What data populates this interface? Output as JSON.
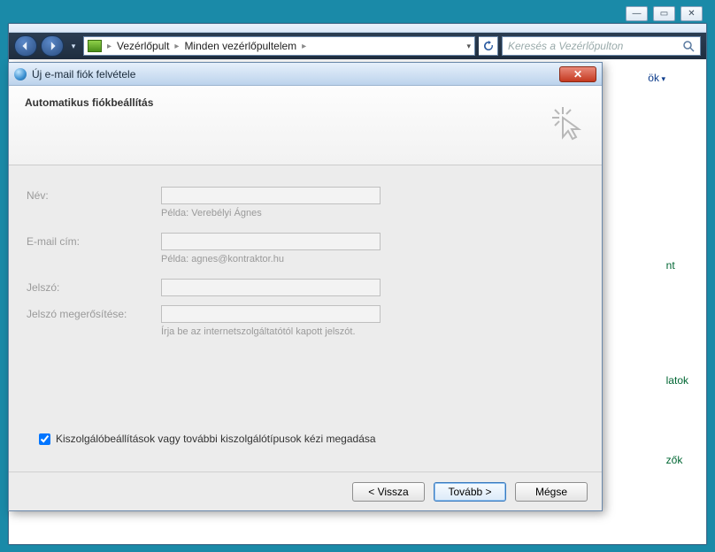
{
  "window_buttons": {
    "minimize": "—",
    "maximize": "▭",
    "close": "✕"
  },
  "breadcrumbs": {
    "root_icon": "control-panel",
    "items": [
      "Vezérlőpult",
      "Minden vezérlőpultelem"
    ]
  },
  "search": {
    "placeholder": "Keresés a Vezérlőpulton"
  },
  "tools_link": "ök",
  "peek_links": [
    "nt",
    "latok",
    "zők"
  ],
  "dialog": {
    "title": "Új e-mail fiók felvétele",
    "heading": "Automatikus fiókbeállítás",
    "fields": {
      "name": {
        "label": "Név:",
        "value": "",
        "hint": "Példa: Verebélyi Ágnes"
      },
      "email": {
        "label": "E-mail cím:",
        "value": "",
        "hint": "Példa: agnes@kontraktor.hu"
      },
      "password": {
        "label": "Jelszó:",
        "value": ""
      },
      "password_confirm": {
        "label": "Jelszó megerősítése:",
        "value": "",
        "hint": "Írja be az internetszolgáltatótól kapott jelszót."
      }
    },
    "checkbox": {
      "checked": true,
      "label": "Kiszolgálóbeállítások vagy további kiszolgálótípusok kézi megadása"
    },
    "buttons": {
      "back": "< Vissza",
      "next": "Tovább >",
      "cancel": "Mégse"
    }
  }
}
